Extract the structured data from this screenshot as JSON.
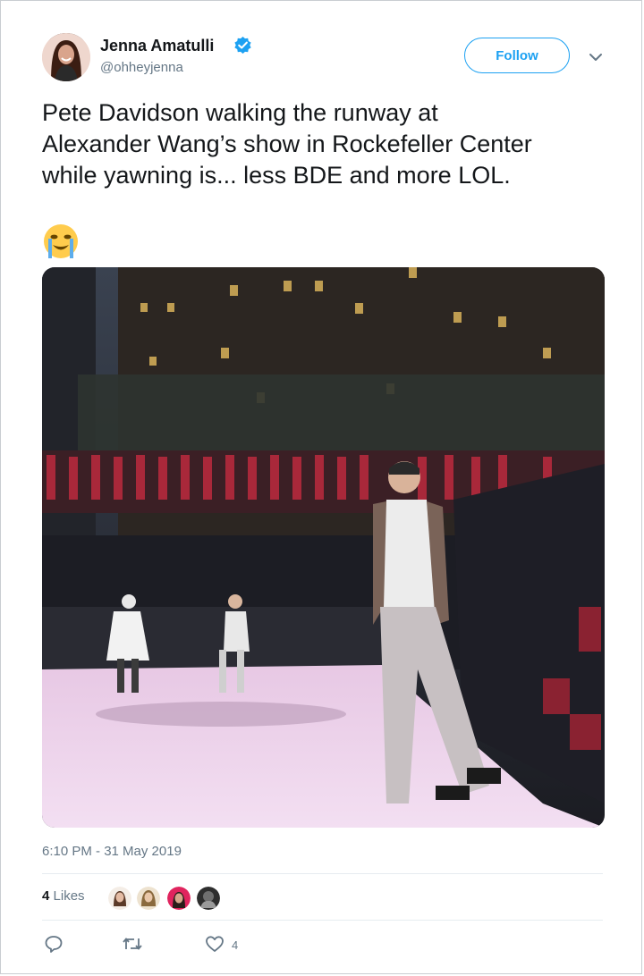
{
  "author": {
    "name": "Jenna Amatulli",
    "handle": "@ohheyjenna",
    "verified": true
  },
  "follow_label": "Follow",
  "tweet": {
    "lines": [
      "Pete Davidson walking the runway at",
      "Alexander Wang’s show in Rockefeller Center",
      "while yawning is... less BDE and more LOL."
    ],
    "emoji": "crying-face-emoji"
  },
  "timestamp": "6:10 PM - 31 May 2019",
  "likes": {
    "count": "4",
    "label": "Likes"
  },
  "actions": {
    "like_count": "4"
  },
  "colors": {
    "accent": "#1da1f2",
    "secondary_text": "#657786",
    "divider": "#e6ecf0"
  }
}
